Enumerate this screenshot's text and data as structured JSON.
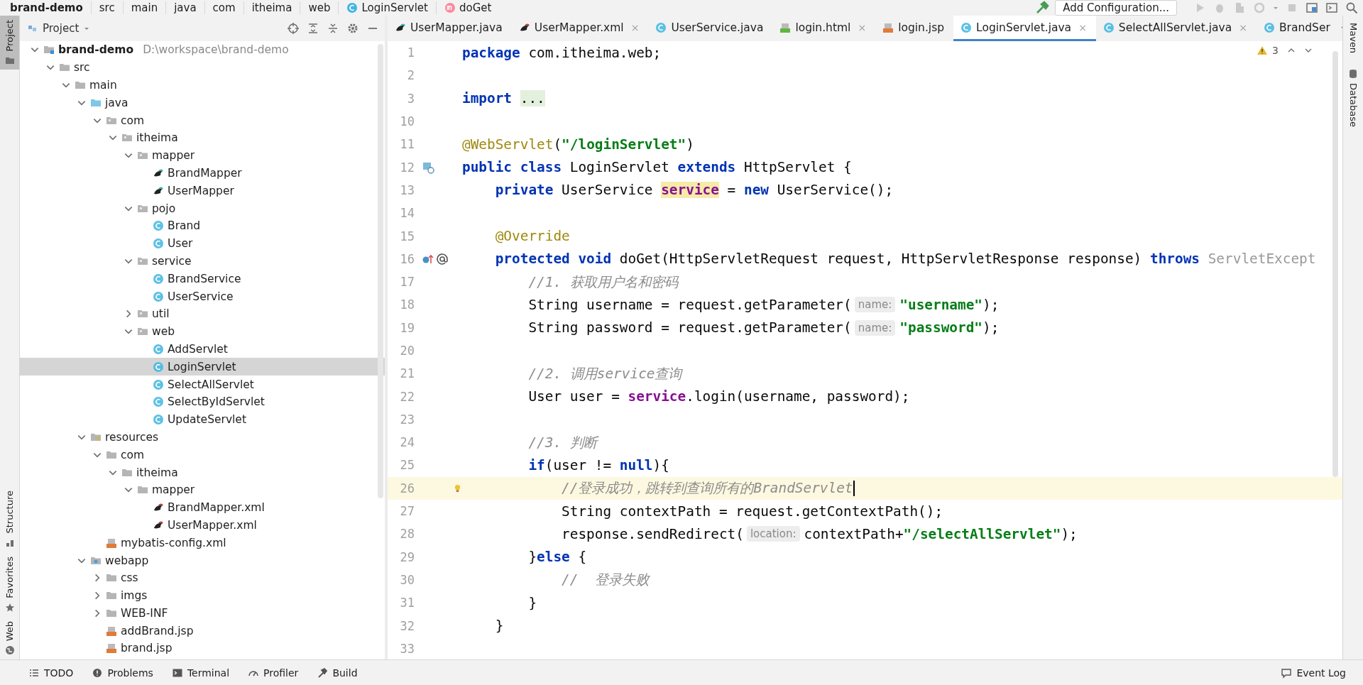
{
  "breadcrumb": [
    {
      "label": "brand-demo",
      "kind": "project"
    },
    {
      "label": "src",
      "kind": "plain"
    },
    {
      "label": "main",
      "kind": "plain"
    },
    {
      "label": "java",
      "kind": "plain"
    },
    {
      "label": "com",
      "kind": "plain"
    },
    {
      "label": "itheima",
      "kind": "plain"
    },
    {
      "label": "web",
      "kind": "plain"
    },
    {
      "label": "LoginServlet",
      "kind": "class"
    },
    {
      "label": "doGet",
      "kind": "method"
    }
  ],
  "toolbar": {
    "run_config": "Add Configuration..."
  },
  "left_strip": [
    {
      "label": "Project",
      "kind": "project",
      "selected": true
    },
    {
      "label": "Structure",
      "kind": "structure",
      "selected": false
    },
    {
      "label": "Favorites",
      "kind": "favorites",
      "selected": false
    },
    {
      "label": "Web",
      "kind": "web",
      "selected": false
    }
  ],
  "right_strip": [
    {
      "label": "Maven",
      "kind": "maven"
    },
    {
      "label": "Database",
      "kind": "database"
    }
  ],
  "project": {
    "title": "Project",
    "tree": [
      {
        "label": "brand-demo",
        "path": "D:\\workspace\\brand-demo",
        "kind": "module",
        "expanded": true,
        "selected": false,
        "children": [
          {
            "label": "src",
            "kind": "folder",
            "expanded": true,
            "selected": false,
            "children": [
              {
                "label": "main",
                "kind": "folder",
                "expanded": true,
                "selected": false,
                "children": [
                  {
                    "label": "java",
                    "kind": "source-folder",
                    "expanded": true,
                    "selected": false,
                    "children": [
                      {
                        "label": "com",
                        "kind": "package",
                        "expanded": true,
                        "selected": false,
                        "children": [
                          {
                            "label": "itheima",
                            "kind": "package",
                            "expanded": true,
                            "selected": false,
                            "children": [
                              {
                                "label": "mapper",
                                "kind": "package",
                                "expanded": true,
                                "selected": false,
                                "children": [
                                  {
                                    "label": "BrandMapper",
                                    "kind": "mapper",
                                    "selected": false
                                  },
                                  {
                                    "label": "UserMapper",
                                    "kind": "mapper",
                                    "selected": false
                                  }
                                ]
                              },
                              {
                                "label": "pojo",
                                "kind": "package",
                                "expanded": true,
                                "selected": false,
                                "children": [
                                  {
                                    "label": "Brand",
                                    "kind": "class",
                                    "selected": false
                                  },
                                  {
                                    "label": "User",
                                    "kind": "class",
                                    "selected": false
                                  }
                                ]
                              },
                              {
                                "label": "service",
                                "kind": "package",
                                "expanded": true,
                                "selected": false,
                                "children": [
                                  {
                                    "label": "BrandService",
                                    "kind": "class",
                                    "selected": false
                                  },
                                  {
                                    "label": "UserService",
                                    "kind": "class",
                                    "selected": false
                                  }
                                ]
                              },
                              {
                                "label": "util",
                                "kind": "package",
                                "expanded": false,
                                "selected": false
                              },
                              {
                                "label": "web",
                                "kind": "package",
                                "expanded": true,
                                "selected": false,
                                "children": [
                                  {
                                    "label": "AddServlet",
                                    "kind": "class",
                                    "selected": false
                                  },
                                  {
                                    "label": "LoginServlet",
                                    "kind": "class",
                                    "selected": true
                                  },
                                  {
                                    "label": "SelectAllServlet",
                                    "kind": "class",
                                    "selected": false
                                  },
                                  {
                                    "label": "SelectByIdServlet",
                                    "kind": "class",
                                    "selected": false
                                  },
                                  {
                                    "label": "UpdateServlet",
                                    "kind": "class",
                                    "selected": false
                                  }
                                ]
                              }
                            ]
                          }
                        ]
                      }
                    ]
                  },
                  {
                    "label": "resources",
                    "kind": "resource-folder",
                    "expanded": true,
                    "selected": false,
                    "children": [
                      {
                        "label": "com",
                        "kind": "folder",
                        "expanded": true,
                        "selected": false,
                        "children": [
                          {
                            "label": "itheima",
                            "kind": "folder",
                            "expanded": true,
                            "selected": false,
                            "children": [
                              {
                                "label": "mapper",
                                "kind": "folder",
                                "expanded": true,
                                "selected": false,
                                "children": [
                                  {
                                    "label": "BrandMapper.xml",
                                    "kind": "mapper-xml",
                                    "selected": false
                                  },
                                  {
                                    "label": "UserMapper.xml",
                                    "kind": "mapper-xml",
                                    "selected": false
                                  }
                                ]
                              }
                            ]
                          }
                        ]
                      },
                      {
                        "label": "mybatis-config.xml",
                        "kind": "xml",
                        "selected": false
                      }
                    ]
                  },
                  {
                    "label": "webapp",
                    "kind": "web-folder",
                    "expanded": true,
                    "selected": false,
                    "children": [
                      {
                        "label": "css",
                        "kind": "folder",
                        "expanded": false,
                        "selected": false
                      },
                      {
                        "label": "imgs",
                        "kind": "folder",
                        "expanded": false,
                        "selected": false
                      },
                      {
                        "label": "WEB-INF",
                        "kind": "folder",
                        "expanded": false,
                        "selected": false
                      },
                      {
                        "label": "addBrand.jsp",
                        "kind": "jsp",
                        "selected": false
                      },
                      {
                        "label": "brand.jsp",
                        "kind": "jsp",
                        "selected": false
                      }
                    ]
                  }
                ]
              }
            ]
          }
        ]
      }
    ]
  },
  "tabs": [
    {
      "label": "UserMapper.java",
      "kind": "mapper",
      "selected": false
    },
    {
      "label": "UserMapper.xml",
      "kind": "mapper-xml",
      "selected": false,
      "close": "×"
    },
    {
      "label": "UserService.java",
      "kind": "class",
      "selected": false
    },
    {
      "label": "login.html",
      "kind": "html",
      "selected": false,
      "close": "×"
    },
    {
      "label": "login.jsp",
      "kind": "jsp",
      "selected": false
    },
    {
      "label": "LoginServlet.java",
      "kind": "class",
      "selected": true,
      "close": "×"
    },
    {
      "label": "SelectAllServlet.java",
      "kind": "class",
      "selected": false,
      "close": "×"
    },
    {
      "label": "BrandSer",
      "kind": "class",
      "selected": false
    }
  ],
  "inspections": {
    "warnings": "3"
  },
  "code": [
    {
      "number": "1",
      "kind": "plain",
      "current": false,
      "tokens": [
        {
          "kind": "keyword",
          "text": "package"
        },
        {
          "kind": "plain",
          "text": " com.itheima.web;"
        }
      ]
    },
    {
      "number": "2",
      "kind": "plain",
      "current": false
    },
    {
      "number": "3",
      "kind": "plain",
      "current": false,
      "tokens": [
        {
          "kind": "keyword",
          "text": "import "
        },
        {
          "kind": "folded",
          "text": "..."
        }
      ]
    },
    {
      "number": "10",
      "kind": "plain",
      "current": false
    },
    {
      "number": "11",
      "kind": "plain",
      "current": false,
      "tokens": [
        {
          "kind": "annotation",
          "text": "@WebServlet"
        },
        {
          "kind": "plain",
          "text": "("
        },
        {
          "kind": "string",
          "text": "\"/loginServlet\""
        },
        {
          "kind": "plain",
          "text": ")"
        }
      ]
    },
    {
      "number": "12",
      "kind": "implemented",
      "current": false,
      "tokens": [
        {
          "kind": "keyword",
          "text": "public class"
        },
        {
          "kind": "plain",
          "text": " LoginServlet "
        },
        {
          "kind": "keyword",
          "text": "extends"
        },
        {
          "kind": "plain",
          "text": " HttpServlet {"
        }
      ]
    },
    {
      "number": "13",
      "kind": "plain",
      "current": false,
      "tokens": [
        {
          "kind": "keyword",
          "text": "    private"
        },
        {
          "kind": "plain",
          "text": " UserService "
        },
        {
          "kind": "field-highlight",
          "text": "service"
        },
        {
          "kind": "plain",
          "text": " = "
        },
        {
          "kind": "keyword",
          "text": "new"
        },
        {
          "kind": "plain",
          "text": " UserService();"
        }
      ]
    },
    {
      "number": "14",
      "kind": "plain",
      "current": false
    },
    {
      "number": "15",
      "kind": "plain",
      "current": false,
      "tokens": [
        {
          "kind": "annotation",
          "text": "    @Override"
        }
      ]
    },
    {
      "number": "16",
      "kind": "override",
      "current": false,
      "tokens": [
        {
          "kind": "keyword",
          "text": "    protected void"
        },
        {
          "kind": "plain",
          "text": " doGet(HttpServletRequest request, HttpServletResponse response) "
        },
        {
          "kind": "keyword",
          "text": "throws"
        },
        {
          "kind": "dim",
          "text": " ServletExcept"
        }
      ]
    },
    {
      "number": "17",
      "kind": "plain",
      "current": false,
      "tokens": [
        {
          "kind": "comment",
          "text": "        //1. 获取用户名和密码"
        }
      ]
    },
    {
      "number": "18",
      "kind": "plain",
      "current": false,
      "tokens": [
        {
          "kind": "plain",
          "text": "        String username = request.getParameter("
        },
        {
          "kind": "hint",
          "text": "name:"
        },
        {
          "kind": "string",
          "text": "\"username\""
        },
        {
          "kind": "plain",
          "text": ");"
        }
      ]
    },
    {
      "number": "19",
      "kind": "plain",
      "current": false,
      "tokens": [
        {
          "kind": "plain",
          "text": "        String password = request.getParameter("
        },
        {
          "kind": "hint",
          "text": "name:"
        },
        {
          "kind": "string",
          "text": "\"password\""
        },
        {
          "kind": "plain",
          "text": ");"
        }
      ]
    },
    {
      "number": "20",
      "kind": "plain",
      "current": false
    },
    {
      "number": "21",
      "kind": "plain",
      "current": false,
      "tokens": [
        {
          "kind": "comment",
          "text": "        //2. 调用service查询"
        }
      ]
    },
    {
      "number": "22",
      "kind": "plain",
      "current": false,
      "tokens": [
        {
          "kind": "plain",
          "text": "        User user = "
        },
        {
          "kind": "field",
          "text": "service"
        },
        {
          "kind": "plain",
          "text": ".login(username, password);"
        }
      ]
    },
    {
      "number": "23",
      "kind": "plain",
      "current": false
    },
    {
      "number": "24",
      "kind": "plain",
      "current": false,
      "tokens": [
        {
          "kind": "comment",
          "text": "        //3. 判断"
        }
      ]
    },
    {
      "number": "25",
      "kind": "plain",
      "current": false,
      "tokens": [
        {
          "kind": "keyword",
          "text": "        if"
        },
        {
          "kind": "plain",
          "text": "(user != "
        },
        {
          "kind": "keyword",
          "text": "null"
        },
        {
          "kind": "plain",
          "text": "){"
        }
      ]
    },
    {
      "number": "26",
      "kind": "bulb",
      "current": true,
      "tokens": [
        {
          "kind": "comment",
          "text": "            //登录成功，跳转到查询所有的BrandServlet"
        }
      ]
    },
    {
      "number": "27",
      "kind": "plain",
      "current": false,
      "tokens": [
        {
          "kind": "plain",
          "text": "            String contextPath = request.getContextPath();"
        }
      ]
    },
    {
      "number": "28",
      "kind": "plain",
      "current": false,
      "tokens": [
        {
          "kind": "plain",
          "text": "            response.sendRedirect("
        },
        {
          "kind": "hint",
          "text": "location:"
        },
        {
          "kind": "plain",
          "text": "contextPath+"
        },
        {
          "kind": "string",
          "text": "\"/selectAllServlet\""
        },
        {
          "kind": "plain",
          "text": ");"
        }
      ]
    },
    {
      "number": "29",
      "kind": "plain",
      "current": false,
      "tokens": [
        {
          "kind": "plain",
          "text": "        }"
        },
        {
          "kind": "keyword",
          "text": "else"
        },
        {
          "kind": "plain",
          "text": " {"
        }
      ]
    },
    {
      "number": "30",
      "kind": "plain",
      "current": false,
      "tokens": [
        {
          "kind": "comment",
          "text": "            //  登录失败"
        }
      ]
    },
    {
      "number": "31",
      "kind": "plain",
      "current": false,
      "tokens": [
        {
          "kind": "plain",
          "text": "        }"
        }
      ]
    },
    {
      "number": "32",
      "kind": "plain",
      "current": false,
      "tokens": [
        {
          "kind": "plain",
          "text": "    }"
        }
      ]
    },
    {
      "number": "33",
      "kind": "plain",
      "current": false
    }
  ],
  "bottom_tools": [
    {
      "label": "TODO",
      "kind": "todo"
    },
    {
      "label": "Problems",
      "kind": "problems"
    },
    {
      "label": "Terminal",
      "kind": "terminal"
    },
    {
      "label": "Profiler",
      "kind": "profiler"
    },
    {
      "label": "Build",
      "kind": "build"
    }
  ],
  "event_log": "Event Log"
}
